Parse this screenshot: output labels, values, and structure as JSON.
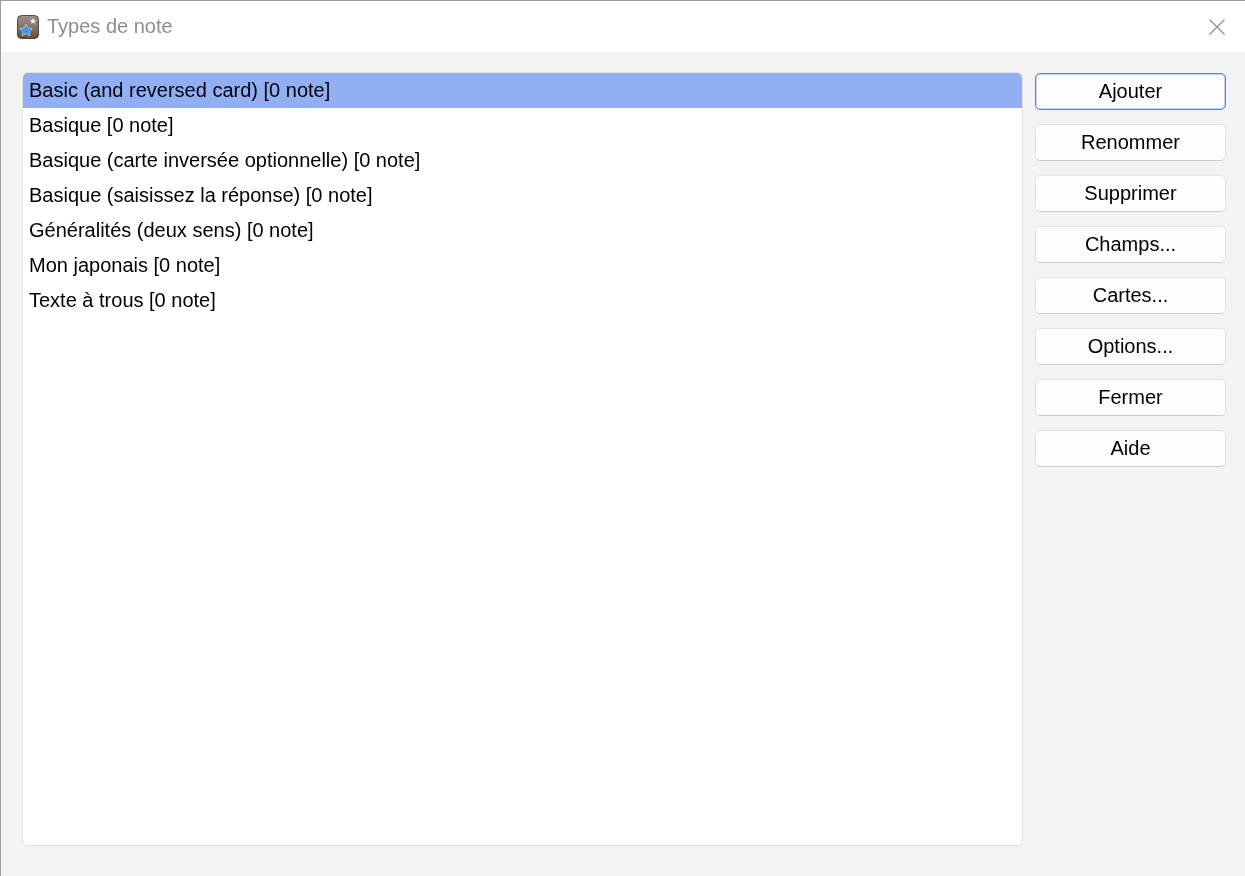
{
  "window": {
    "title": "Types de note"
  },
  "note_types": [
    {
      "name": "Basic (and reversed card) [0 note]",
      "selected": true
    },
    {
      "name": "Basique [0 note]",
      "selected": false
    },
    {
      "name": "Basique (carte inversée optionnelle) [0 note]",
      "selected": false
    },
    {
      "name": "Basique (saisissez la réponse) [0 note]",
      "selected": false
    },
    {
      "name": "Généralités (deux sens) [0 note]",
      "selected": false
    },
    {
      "name": "Mon japonais [0 note]",
      "selected": false
    },
    {
      "name": "Texte à trous [0 note]",
      "selected": false
    }
  ],
  "buttons": [
    {
      "label": "Ajouter",
      "default": true
    },
    {
      "label": "Renommer",
      "default": false
    },
    {
      "label": "Supprimer",
      "default": false
    },
    {
      "label": "Champs...",
      "default": false
    },
    {
      "label": "Cartes...",
      "default": false
    },
    {
      "label": "Options...",
      "default": false
    },
    {
      "label": "Fermer",
      "default": false
    },
    {
      "label": "Aide",
      "default": false
    }
  ]
}
